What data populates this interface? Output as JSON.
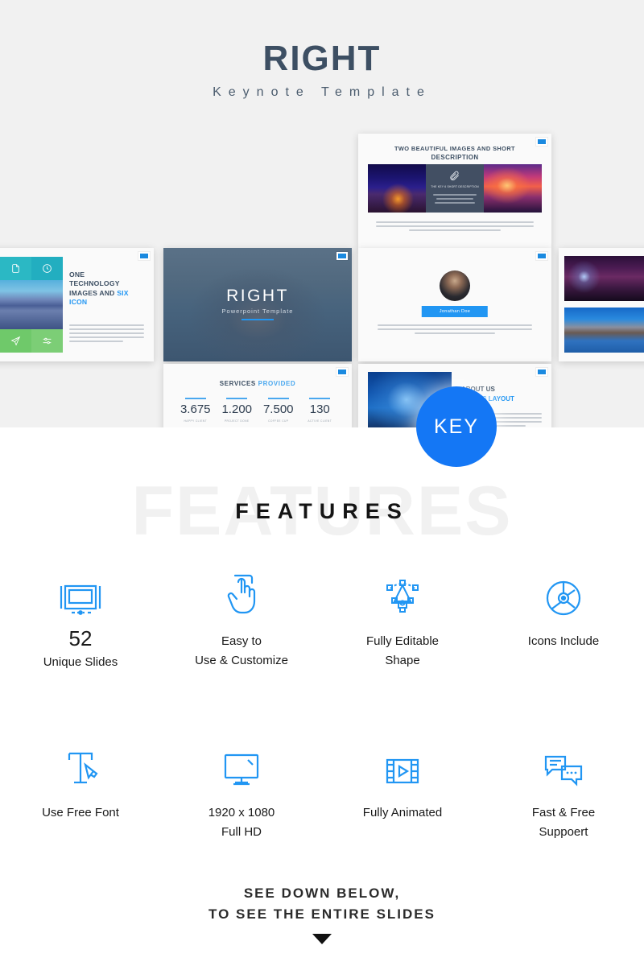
{
  "hero": {
    "title": "RIGHT",
    "subtitle": "Keynote  Template",
    "bg_color": "#f1f1f1",
    "title_color": "#3d4f63"
  },
  "key_badge": {
    "label": "KEY",
    "color": "#1477f5"
  },
  "slides": {
    "two_images": {
      "title_line1": "TWO BEAUTIFUL IMAGES AND SHORT",
      "title_line2": "DESCRIPTION",
      "panel_heading": "THE KEY 6 SHORT DESCRIPTION",
      "panel_icon": "paperclip-icon"
    },
    "six_icon": {
      "title_line1": "ONE",
      "title_line2": "TECHNOLOGY",
      "title_line3": "IMAGES AND ",
      "title_highlight": "SIX",
      "title_line4": "ICON",
      "tile_icons": [
        "document-icon",
        "clock-icon",
        "paper-plane-icon",
        "sliders-icon"
      ]
    },
    "cover": {
      "title": "RIGHT",
      "subtitle": "Powerpoint Template"
    },
    "profile": {
      "name_button": "Jonathan Doe",
      "avatar": "person-avatar"
    },
    "services": {
      "title_plain": "SERVICES ",
      "title_highlight": "PROVIDED",
      "stats": [
        {
          "value": "3.675",
          "label": "HAPPY CLIENT"
        },
        {
          "value": "1.200",
          "label": "PROJECT DONE"
        },
        {
          "value": "7.500",
          "label": "COFFEE CUP"
        },
        {
          "value": "130",
          "label": "ACTIVE CLIENT"
        }
      ]
    },
    "about": {
      "title_line1": "ABOUT US",
      "title_line2_plain": "",
      "title_line2_highlight": "IMAGES LAYOUT"
    }
  },
  "features": {
    "watermark": "FEATURES",
    "heading": "FEATURES",
    "items": [
      {
        "icon": "presentation-screen-icon",
        "big": "52",
        "caption_line1": "Unique Slides",
        "caption_line2": ""
      },
      {
        "icon": "hand-click-icon",
        "big": "",
        "caption_line1": "Easy to",
        "caption_line2": "Use & Customize"
      },
      {
        "icon": "pen-vector-icon",
        "big": "",
        "caption_line1": "Fully Editable",
        "caption_line2": "Shape"
      },
      {
        "icon": "compact-disc-icon",
        "big": "",
        "caption_line1": "Icons Include",
        "caption_line2": ""
      },
      {
        "icon": "type-tool-icon",
        "big": "",
        "caption_line1": "Use Free Font",
        "caption_line2": ""
      },
      {
        "icon": "monitor-icon",
        "big": "",
        "caption_line1": "1920 x 1080",
        "caption_line2": "Full HD"
      },
      {
        "icon": "film-play-icon",
        "big": "",
        "caption_line1": "Fully Animated",
        "caption_line2": ""
      },
      {
        "icon": "chat-bubbles-icon",
        "big": "",
        "caption_line1": "Fast & Free",
        "caption_line2": "Suppoert"
      }
    ],
    "icon_color": "#2196f3"
  },
  "footer": {
    "line1": "SEE DOWN BELOW,",
    "line2": "TO SEE THE ENTIRE SLIDES",
    "arrow": "chevron-down-triangle"
  }
}
